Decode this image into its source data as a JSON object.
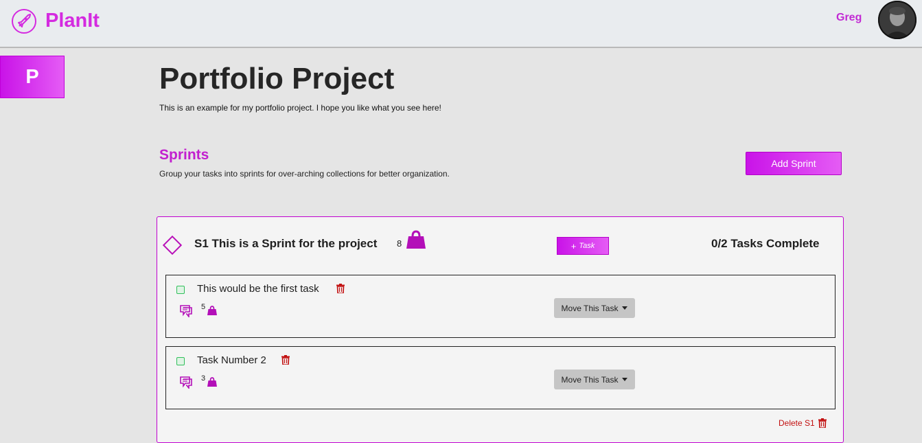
{
  "navbar": {
    "brand": "PlanIt",
    "user": "Greg"
  },
  "sidebar": {
    "project_initial": "P"
  },
  "project": {
    "title": "Portfolio Project",
    "description": "This is an example for my portfolio project. I hope you like what you see here!"
  },
  "sprints_section": {
    "heading": "Sprints",
    "description": "Group your tasks into sprints for over-arching collections for better organization.",
    "add_button": "Add Sprint"
  },
  "sprint": {
    "title": "S1 This is a Sprint for the project",
    "weight": "8",
    "add_task_label": "Task",
    "add_task_plus": "+",
    "completion": "0/2 Tasks Complete",
    "delete_label": "Delete S1",
    "tasks": [
      {
        "name": "This would be the first task",
        "weight": "5",
        "move_label": "Move This Task"
      },
      {
        "name": "Task Number 2",
        "weight": "3",
        "move_label": "Move This Task"
      }
    ]
  },
  "colors": {
    "accent": "#c913e8",
    "accent_light": "#e55cf5",
    "danger": "#c21010",
    "check": "#2fbf5a"
  },
  "icons": [
    "rocket-icon",
    "weight-icon",
    "trash-icon",
    "comment-icon",
    "caret-down-icon",
    "diamond-icon"
  ]
}
